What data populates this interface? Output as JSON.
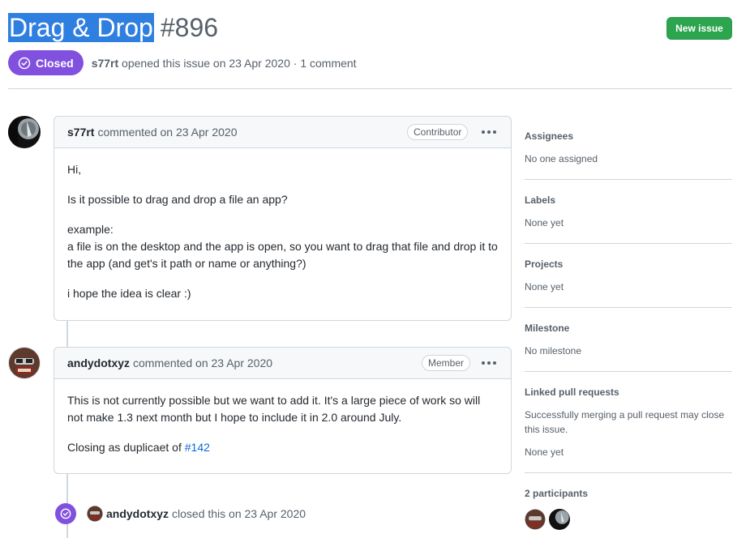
{
  "issue": {
    "title": "Drag & Drop",
    "number": "#896",
    "state": "Closed",
    "author": "s77rt",
    "opened_text": "opened this issue on 23 Apr 2020 · 1 comment",
    "new_issue_label": "New issue"
  },
  "comments": [
    {
      "author": "s77rt",
      "action": "commented on 23 Apr 2020",
      "role": "Contributor",
      "body": [
        "Hi,",
        "Is it possible to drag and drop a file an app?",
        "example:",
        "a file is on the desktop and the app is open, so you want to drag that file and drop it to the app (and get's it path or name or anything?)",
        "i hope the idea is clear :)"
      ]
    },
    {
      "author": "andydotxyz",
      "action": "commented on 23 Apr 2020",
      "role": "Member",
      "body": [
        "This is not currently possible but we want to add it. It's a large piece of work so will not make 1.3 next month but I hope to include it in 2.0 around July.",
        "Closing as duplicaet of"
      ],
      "link": "#142"
    }
  ],
  "closed_event": {
    "actor": "andydotxyz",
    "text": "closed this on 23 Apr 2020"
  },
  "sidebar": {
    "assignees": {
      "title": "Assignees",
      "value": "No one assigned"
    },
    "labels": {
      "title": "Labels",
      "value": "None yet"
    },
    "projects": {
      "title": "Projects",
      "value": "None yet"
    },
    "milestone": {
      "title": "Milestone",
      "value": "No milestone"
    },
    "linked_prs": {
      "title": "Linked pull requests",
      "desc": "Successfully merging a pull request may close this issue.",
      "value": "None yet"
    },
    "participants": {
      "title": "2 participants"
    }
  },
  "colors": {
    "closed_purple": "#8250df",
    "new_issue_green": "#2da44e",
    "link_blue": "#0969da",
    "selection_blue": "#2f7fe0"
  }
}
